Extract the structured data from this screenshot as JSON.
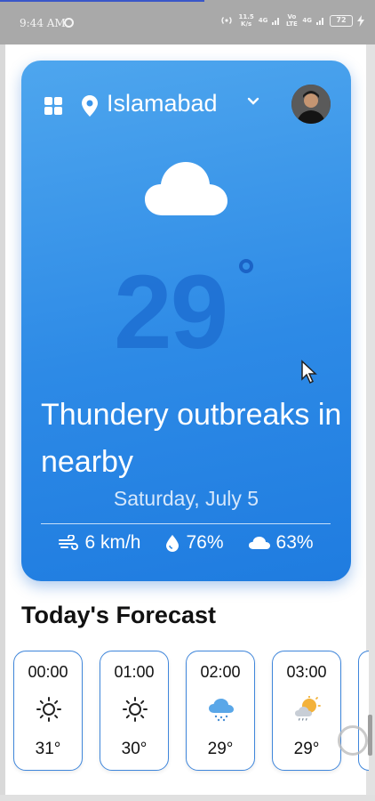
{
  "status_bar": {
    "time": "9:44 AM",
    "net_speed_value": "11.5",
    "net_speed_unit": "K/s",
    "sim1_label": "4G",
    "volte_label": "Vo LTE",
    "sim2_label": "4G",
    "battery": "72"
  },
  "header": {
    "menu_icon": "grid-icon",
    "location_icon": "pin-icon",
    "city": "Islamabad",
    "dropdown_icon": "chevron-down-icon",
    "avatar_icon": "avatar"
  },
  "current": {
    "icon": "cloud-icon",
    "temperature": "29",
    "condition": "Thundery outbreaks in nearby",
    "date": "Saturday, July 5",
    "wind": "6 km/h",
    "humidity": "76%",
    "cloud_cover": "63%"
  },
  "forecast": {
    "title": "Today's Forecast",
    "items": [
      {
        "time": "00:00",
        "icon": "sun-icon",
        "temp": "31°"
      },
      {
        "time": "01:00",
        "icon": "sun-icon",
        "temp": "30°"
      },
      {
        "time": "02:00",
        "icon": "rain-cloud-icon",
        "temp": "29°"
      },
      {
        "time": "03:00",
        "icon": "sun-cloud-icon",
        "temp": "29°"
      }
    ]
  },
  "colors": {
    "card_top": "#4ea6ee",
    "card_bottom": "#1f7ce0",
    "forecast_border": "#3f86db"
  }
}
